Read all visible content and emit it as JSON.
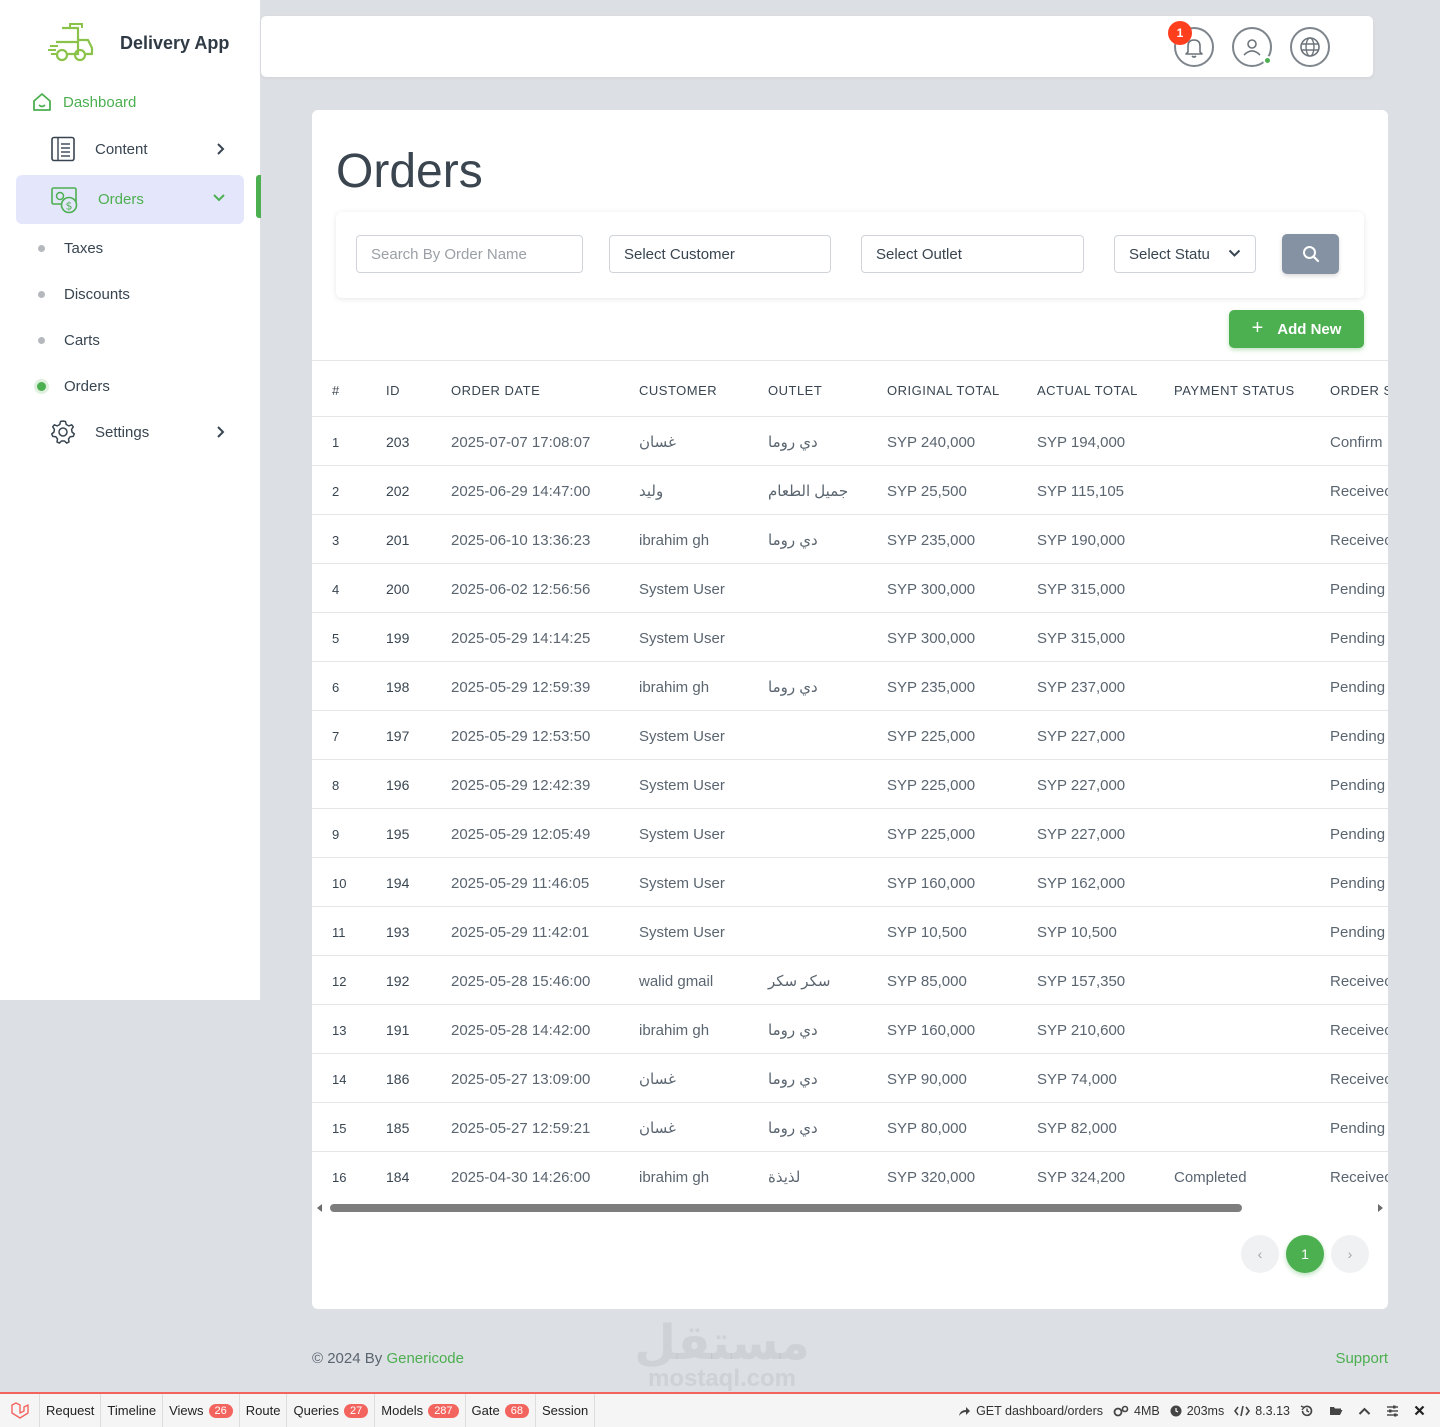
{
  "brand": {
    "name": "Delivery App"
  },
  "sidebar": {
    "dashboard": "Dashboard",
    "content": "Content",
    "orders": "Orders",
    "sub_items": [
      "Taxes",
      "Discounts",
      "Carts",
      "Orders"
    ],
    "settings": "Settings"
  },
  "topbar": {
    "notification_count": "1"
  },
  "page": {
    "title": "Orders"
  },
  "filters": {
    "search_placeholder": "Search By Order Name",
    "customer": "Select Customer",
    "outlet": "Select Outlet",
    "status": "Select Statu"
  },
  "add_new": "Add New",
  "table": {
    "headers": [
      "#",
      "ID",
      "ORDER DATE",
      "CUSTOMER",
      "OUTLET",
      "ORIGINAL TOTAL",
      "ACTUAL TOTAL",
      "PAYMENT STATUS",
      "ORDER S"
    ],
    "rows": [
      [
        "1",
        "203",
        "2025-07-07 17:08:07",
        "غسان",
        "دي روما",
        "SYP 240,000",
        "SYP 194,000",
        "",
        "Confirm"
      ],
      [
        "2",
        "202",
        "2025-06-29 14:47:00",
        "وليد",
        "جميل الطعام",
        "SYP 25,500",
        "SYP 115,105",
        "",
        "Receivec"
      ],
      [
        "3",
        "201",
        "2025-06-10 13:36:23",
        "ibrahim gh",
        "دي روما",
        "SYP 235,000",
        "SYP 190,000",
        "",
        "Receivec"
      ],
      [
        "4",
        "200",
        "2025-06-02 12:56:56",
        "System User",
        "",
        "SYP 300,000",
        "SYP 315,000",
        "",
        "Pending"
      ],
      [
        "5",
        "199",
        "2025-05-29 14:14:25",
        "System User",
        "",
        "SYP 300,000",
        "SYP 315,000",
        "",
        "Pending"
      ],
      [
        "6",
        "198",
        "2025-05-29 12:59:39",
        "ibrahim gh",
        "دي روما",
        "SYP 235,000",
        "SYP 237,000",
        "",
        "Pending"
      ],
      [
        "7",
        "197",
        "2025-05-29 12:53:50",
        "System User",
        "",
        "SYP 225,000",
        "SYP 227,000",
        "",
        "Pending"
      ],
      [
        "8",
        "196",
        "2025-05-29 12:42:39",
        "System User",
        "",
        "SYP 225,000",
        "SYP 227,000",
        "",
        "Pending"
      ],
      [
        "9",
        "195",
        "2025-05-29 12:05:49",
        "System User",
        "",
        "SYP 225,000",
        "SYP 227,000",
        "",
        "Pending"
      ],
      [
        "10",
        "194",
        "2025-05-29 11:46:05",
        "System User",
        "",
        "SYP 160,000",
        "SYP 162,000",
        "",
        "Pending"
      ],
      [
        "11",
        "193",
        "2025-05-29 11:42:01",
        "System User",
        "",
        "SYP 10,500",
        "SYP 10,500",
        "",
        "Pending"
      ],
      [
        "12",
        "192",
        "2025-05-28 15:46:00",
        "walid gmail",
        "سكر سكر",
        "SYP 85,000",
        "SYP 157,350",
        "",
        "Receivec"
      ],
      [
        "13",
        "191",
        "2025-05-28 14:42:00",
        "ibrahim gh",
        "دي روما",
        "SYP 160,000",
        "SYP 210,600",
        "",
        "Receivec"
      ],
      [
        "14",
        "186",
        "2025-05-27 13:09:00",
        "غسان",
        "دي روما",
        "SYP 90,000",
        "SYP 74,000",
        "",
        "Receivec"
      ],
      [
        "15",
        "185",
        "2025-05-27 12:59:21",
        "غسان",
        "دي روما",
        "SYP 80,000",
        "SYP 82,000",
        "",
        "Pending"
      ],
      [
        "16",
        "184",
        "2025-04-30 14:26:00",
        "ibrahim gh",
        "لذيذة",
        "SYP 320,000",
        "SYP 324,200",
        "Completed",
        "Receivec"
      ]
    ]
  },
  "pagination": {
    "current": "1",
    "prev": "‹",
    "next": "›"
  },
  "footer": {
    "copyright": "© 2024 By ",
    "brand": "Genericode",
    "support": "Support"
  },
  "watermark": {
    "arabic": "مستقل",
    "latin": "mostaql.com"
  },
  "debugbar": {
    "tabs": [
      {
        "label": "Request",
        "badge": ""
      },
      {
        "label": "Timeline",
        "badge": ""
      },
      {
        "label": "Views",
        "badge": "26"
      },
      {
        "label": "Route",
        "badge": ""
      },
      {
        "label": "Queries",
        "badge": "27"
      },
      {
        "label": "Models",
        "badge": "287"
      },
      {
        "label": "Gate",
        "badge": "68"
      },
      {
        "label": "Session",
        "badge": ""
      }
    ],
    "route": "GET dashboard/orders",
    "memory": "4MB",
    "time": "203ms",
    "php": "8.3.13"
  },
  "colors": {
    "accent": "#4caf50",
    "badge": "#ff3e1d",
    "search_button": "#8592a3",
    "debug_red": "#f4645f"
  }
}
